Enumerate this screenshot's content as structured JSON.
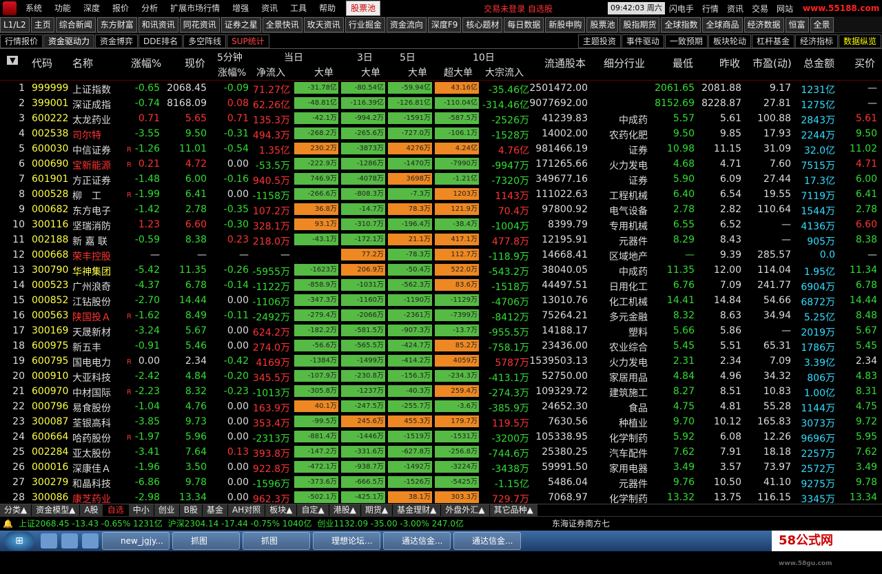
{
  "menubar": {
    "items": [
      "系统",
      "功能",
      "深度",
      "报价",
      "分析",
      "扩展市场行情",
      "增强",
      "资讯",
      "工具",
      "帮助"
    ],
    "pool_tab": "股票池",
    "notice": "交易未登录  自选股",
    "time": "09:42:03",
    "weekday": "周六",
    "right_items": [
      "闪电手",
      "行情",
      "资讯",
      "交易",
      "网站"
    ],
    "watermark": "www.55188.com"
  },
  "toolbar": {
    "buttons": [
      "L1/L2",
      "主页",
      "综合新闻",
      "东方财富",
      "和讯资讯",
      "同花资讯",
      "证券之星",
      "全景快讯",
      "玫天资讯",
      "行业掘金",
      "资金流向",
      "深度F9",
      "核心题材",
      "每日数据",
      "新股申购",
      "股票池",
      "股指期货",
      "全球指数",
      "全球商品",
      "经济数据",
      "恒富",
      "全景"
    ]
  },
  "tabs": {
    "left": [
      "行情报价",
      "资金驱动力",
      "资金博弈",
      "DDE排名",
      "多空阵线",
      "SUP统计"
    ],
    "right": [
      "主题投资",
      "事件驱动",
      "一致预期",
      "板块轮动",
      "杠杆基金",
      "经济指标",
      "数据纵览"
    ]
  },
  "columns": {
    "sort": "▼",
    "code": "代码",
    "name": "名称",
    "change": "涨幅%",
    "price": "现价",
    "m5_top": "5分钟",
    "m5": "涨幅%",
    "today": "当日",
    "net": "净流入",
    "big": "大单",
    "d3": "3日",
    "d3big": "大单",
    "d5": "5日",
    "d5big": "大单",
    "d10": "10日",
    "super": "超大单",
    "block": "大宗流入",
    "float": "流通股本",
    "industry": "细分行业",
    "low": "最低",
    "prev": "昨收",
    "pe": "市盈(动)",
    "amount": "总金额",
    "bid": "买价"
  },
  "rows": [
    {
      "n": 1,
      "code": "999999",
      "name": "上证指数",
      "f": "",
      "chg": "-0.65",
      "price": "2068.45",
      "m5": "-0.09",
      "net": "71.27亿",
      "b1": "-31.78亿",
      "b1v": -31.78,
      "b3": "-80.54亿",
      "b3v": -80.54,
      "b5": "-59.94亿",
      "b5v": -59.94,
      "sb": "43.16亿",
      "sbv": 43.16,
      "blk": "-35.46亿",
      "flt": "2501472.00",
      "ind": "",
      "low": "2061.65",
      "prev": "2081.88",
      "pe": "9.17",
      "amt": "1231亿",
      "bid": "—",
      "nc": "w",
      "pc": "w"
    },
    {
      "n": 2,
      "code": "399001",
      "name": "深证成指",
      "f": "",
      "chg": "-0.74",
      "price": "8168.09",
      "m5": "0.08",
      "net": "62.26亿",
      "b1": "-48.81亿",
      "b1v": -48.81,
      "b3": "-116.39亿",
      "b3v": -116.39,
      "b5": "-126.81亿",
      "b5v": -126.81,
      "sb": "-110.04亿",
      "sbv": -110.04,
      "blk": "-314.46亿",
      "flt": "9077692.00",
      "ind": "",
      "low": "8152.69",
      "prev": "8228.87",
      "pe": "27.81",
      "amt": "1275亿",
      "bid": "—",
      "nc": "w",
      "pc": "w"
    },
    {
      "n": 3,
      "code": "600222",
      "name": "太龙药业",
      "f": "",
      "chg": "0.71",
      "price": "5.65",
      "m5": "0.71",
      "net": "135.3万",
      "b1": "-42.1万",
      "b1v": -42.1,
      "b3": "-994.2万",
      "b3v": -994.2,
      "b5": "-1591万",
      "b5v": -1591,
      "sb": "-587.5万",
      "sbv": -587.5,
      "blk": "-2526万",
      "flt": "41239.83",
      "ind": "中成药",
      "low": "5.57",
      "prev": "5.61",
      "pe": "100.88",
      "amt": "2843万",
      "bid": "5.61",
      "nc": "w",
      "pc": "r"
    },
    {
      "n": 4,
      "code": "002538",
      "name": "司尔特",
      "f": "",
      "chg": "-3.55",
      "price": "9.50",
      "m5": "-0.31",
      "net": "494.3万",
      "b1": "-268.2万",
      "b1v": -268.2,
      "b3": "-265.6万",
      "b3v": -265.6,
      "b5": "-727.0万",
      "b5v": -727,
      "sb": "-106.1万",
      "sbv": -106.1,
      "blk": "-1528万",
      "flt": "14002.00",
      "ind": "农药化肥",
      "low": "9.50",
      "prev": "9.85",
      "pe": "17.93",
      "amt": "2244万",
      "bid": "9.50",
      "nc": "r",
      "pc": "g"
    },
    {
      "n": 5,
      "code": "600030",
      "name": "中信证券",
      "f": "R",
      "chg": "-1.26",
      "price": "11.01",
      "m5": "-0.54",
      "net": "1.35亿",
      "b1": "230.2万",
      "b1v": 230.2,
      "b3": "-3873万",
      "b3v": -3873,
      "b5": "4276万",
      "b5v": 4276,
      "sb": "4.24亿",
      "sbv": 4.24,
      "blk": "4.76亿",
      "flt": "981466.19",
      "ind": "证券",
      "low": "10.98",
      "prev": "11.15",
      "pe": "31.09",
      "amt": "32.0亿",
      "bid": "11.02",
      "nc": "w",
      "pc": "g"
    },
    {
      "n": 6,
      "code": "000690",
      "name": "宝新能源",
      "f": "R",
      "chg": "0.21",
      "price": "4.72",
      "m5": "0.00",
      "net": "-53.5万",
      "b1": "-222.9万",
      "b1v": -222.9,
      "b3": "-1286万",
      "b3v": -1286,
      "b5": "-1470万",
      "b5v": -1470,
      "sb": "-7990万",
      "sbv": -7990,
      "blk": "-9947万",
      "flt": "171265.66",
      "ind": "火力发电",
      "low": "4.68",
      "prev": "4.71",
      "pe": "7.60",
      "amt": "7515万",
      "bid": "4.71",
      "nc": "r",
      "pc": "r"
    },
    {
      "n": 7,
      "code": "601901",
      "name": "方正证券",
      "f": "",
      "chg": "-1.48",
      "price": "6.00",
      "m5": "-0.16",
      "net": "940.5万",
      "b1": "746.9万",
      "b1v": -746.9,
      "b3": "-4078万",
      "b3v": -4078,
      "b5": "3698万",
      "b5v": 3698,
      "sb": "-1.21亿",
      "sbv": -1.21,
      "blk": "-7320万",
      "flt": "349677.16",
      "ind": "证券",
      "low": "5.90",
      "prev": "6.09",
      "pe": "27.44",
      "amt": "17.3亿",
      "bid": "6.00",
      "nc": "w",
      "pc": "g"
    },
    {
      "n": 8,
      "code": "000528",
      "name": "柳　工",
      "f": "R",
      "chg": "-1.99",
      "price": "6.41",
      "m5": "0.00",
      "net": "-1158万",
      "b1": "-266.6万",
      "b1v": -266.6,
      "b3": "-808.3万",
      "b3v": -808.3,
      "b5": "-7.3万",
      "b5v": -7.3,
      "sb": "1203万",
      "sbv": 1203,
      "blk": "1143万",
      "flt": "111022.63",
      "ind": "工程机械",
      "low": "6.40",
      "prev": "6.54",
      "pe": "19.55",
      "amt": "7119万",
      "bid": "6.41",
      "nc": "w",
      "pc": "g"
    },
    {
      "n": 9,
      "code": "000682",
      "name": "东方电子",
      "f": "",
      "chg": "-1.42",
      "price": "2.78",
      "m5": "-0.35",
      "net": "107.2万",
      "b1": "36.8万",
      "b1v": 36.8,
      "b3": "-14.7万",
      "b3v": -14.7,
      "b5": "78.3万",
      "b5v": 78.3,
      "sb": "121.9万",
      "sbv": 121.9,
      "blk": "70.4万",
      "flt": "97800.92",
      "ind": "电气设备",
      "low": "2.78",
      "prev": "2.82",
      "pe": "110.64",
      "amt": "1544万",
      "bid": "2.78",
      "nc": "w",
      "pc": "g"
    },
    {
      "n": 10,
      "code": "300116",
      "name": "坚瑞消防",
      "f": "",
      "chg": "1.23",
      "price": "6.60",
      "m5": "-0.30",
      "net": "328.1万",
      "b1": "93.1万",
      "b1v": 93.1,
      "b3": "-310.7万",
      "b3v": -310.7,
      "b5": "-196.4万",
      "b5v": -196.4,
      "sb": "-38.4万",
      "sbv": -38.4,
      "blk": "-1004万",
      "flt": "8399.79",
      "ind": "专用机械",
      "low": "6.55",
      "prev": "6.52",
      "pe": "—",
      "amt": "4136万",
      "bid": "6.60",
      "nc": "w",
      "pc": "r"
    },
    {
      "n": 11,
      "code": "002188",
      "name": "新 嘉 联",
      "f": "",
      "chg": "-0.59",
      "price": "8.38",
      "m5": "0.23",
      "net": "218.0万",
      "b1": "-43.1万",
      "b1v": -43.1,
      "b3": "-172.1万",
      "b3v": -172.1,
      "b5": "21.1万",
      "b5v": 21.1,
      "sb": "417.1万",
      "sbv": 417.1,
      "blk": "477.8万",
      "flt": "12195.91",
      "ind": "元器件",
      "low": "8.29",
      "prev": "8.43",
      "pe": "—",
      "amt": "905万",
      "bid": "8.38",
      "nc": "w",
      "pc": "g"
    },
    {
      "n": 12,
      "code": "000668",
      "name": "荣丰控股",
      "f": "",
      "chg": "—",
      "price": "—",
      "m5": "—",
      "net": "—",
      "b1": "",
      "b1v": 0,
      "b3": "77.2万",
      "b3v": 77.2,
      "b5": "-78.3万",
      "b5v": -78.3,
      "sb": "112.7万",
      "sbv": 112.7,
      "blk": "-118.9万",
      "flt": "14668.41",
      "ind": "区域地产",
      "low": "—",
      "prev": "9.39",
      "pe": "285.57",
      "amt": "0.0",
      "bid": "—",
      "nc": "r",
      "pc": "w"
    },
    {
      "n": 13,
      "code": "300790",
      "name": "华神集团",
      "f": "",
      "chg": "-5.42",
      "price": "11.35",
      "m5": "-0.26",
      "net": "-5955万",
      "b1": "-1623万",
      "b1v": -1623,
      "b3": "206.9万",
      "b3v": 206.9,
      "b5": "-50.4万",
      "b5v": -50.4,
      "sb": "522.0万",
      "sbv": 522,
      "blk": "-543.2万",
      "flt": "38040.05",
      "ind": "中成药",
      "low": "11.35",
      "prev": "12.00",
      "pe": "114.04",
      "amt": "1.95亿",
      "bid": "11.34",
      "nc": "y",
      "pc": "g"
    },
    {
      "n": 14,
      "code": "000523",
      "name": "广州浪奇",
      "f": "",
      "chg": "-4.37",
      "price": "6.78",
      "m5": "-0.14",
      "net": "-1122万",
      "b1": "-858.9万",
      "b1v": -858.9,
      "b3": "-1031万",
      "b3v": -1031,
      "b5": "-562.3万",
      "b5v": -562.3,
      "sb": "83.6万",
      "sbv": 83.6,
      "blk": "-1518万",
      "flt": "44497.51",
      "ind": "日用化工",
      "low": "6.76",
      "prev": "7.09",
      "pe": "241.77",
      "amt": "6904万",
      "bid": "6.78",
      "nc": "w",
      "pc": "g"
    },
    {
      "n": 15,
      "code": "000852",
      "name": "江钻股份",
      "f": "",
      "chg": "-2.70",
      "price": "14.44",
      "m5": "0.00",
      "net": "-1106万",
      "b1": "-347.3万",
      "b1v": -347.3,
      "b3": "-1160万",
      "b3v": -1160,
      "b5": "-1190万",
      "b5v": -1190,
      "sb": "-1129万",
      "sbv": -1129,
      "blk": "-4706万",
      "flt": "13010.76",
      "ind": "化工机械",
      "low": "14.41",
      "prev": "14.84",
      "pe": "54.66",
      "amt": "6872万",
      "bid": "14.44",
      "nc": "w",
      "pc": "g"
    },
    {
      "n": 16,
      "code": "000563",
      "name": "陕国投Ａ",
      "f": "R",
      "chg": "-1.62",
      "price": "8.49",
      "m5": "-0.11",
      "net": "-2492万",
      "b1": "-279.4万",
      "b1v": -279.4,
      "b3": "-2066万",
      "b3v": -2066,
      "b5": "-2361万",
      "b5v": -2361,
      "sb": "-7399万",
      "sbv": -7399,
      "blk": "-8412万",
      "flt": "75264.21",
      "ind": "多元金融",
      "low": "8.32",
      "prev": "8.63",
      "pe": "34.94",
      "amt": "5.25亿",
      "bid": "8.48",
      "nc": "r",
      "pc": "g"
    },
    {
      "n": 17,
      "code": "300169",
      "name": "天晟新材",
      "f": "",
      "chg": "-3.24",
      "price": "5.67",
      "m5": "0.00",
      "net": "624.2万",
      "b1": "-182.2万",
      "b1v": -182.2,
      "b3": "-581.5万",
      "b3v": -581.5,
      "b5": "-907.3万",
      "b5v": -907.3,
      "sb": "-13.7万",
      "sbv": -13.7,
      "blk": "-955.5万",
      "flt": "14188.17",
      "ind": "塑料",
      "low": "5.66",
      "prev": "5.86",
      "pe": "—",
      "amt": "2019万",
      "bid": "5.67",
      "nc": "w",
      "pc": "g"
    },
    {
      "n": 18,
      "code": "600975",
      "name": "新五丰",
      "f": "",
      "chg": "-0.91",
      "price": "5.46",
      "m5": "0.00",
      "net": "274.0万",
      "b1": "-56.6万",
      "b1v": -56.6,
      "b3": "-565.5万",
      "b3v": -565.5,
      "b5": "-424.7万",
      "b5v": -424.7,
      "sb": "85.2万",
      "sbv": 85.2,
      "blk": "-758.1万",
      "flt": "23436.00",
      "ind": "农业综合",
      "low": "5.45",
      "prev": "5.51",
      "pe": "65.31",
      "amt": "1786万",
      "bid": "5.45",
      "nc": "w",
      "pc": "g"
    },
    {
      "n": 19,
      "code": "600795",
      "name": "国电电力",
      "f": "R",
      "chg": "0.00",
      "price": "2.34",
      "m5": "-0.42",
      "net": "4169万",
      "b1": "-1384万",
      "b1v": -1384,
      "b3": "-1499万",
      "b3v": -1499,
      "b5": "-414.2万",
      "b5v": -414.2,
      "sb": "4059万",
      "sbv": 4059,
      "blk": "5787万",
      "flt": "1539503.13",
      "ind": "火力发电",
      "low": "2.31",
      "prev": "2.34",
      "pe": "7.09",
      "amt": "3.39亿",
      "bid": "2.34",
      "nc": "w",
      "pc": "w"
    },
    {
      "n": 20,
      "code": "000910",
      "name": "大亚科技",
      "f": "",
      "chg": "-2.42",
      "price": "4.84",
      "m5": "-0.20",
      "net": "345.5万",
      "b1": "-107.9万",
      "b1v": -107.9,
      "b3": "-230.8万",
      "b3v": -230.8,
      "b5": "-156.3万",
      "b5v": -156.3,
      "sb": "-234.3万",
      "sbv": -234.3,
      "blk": "-413.1万",
      "flt": "52750.00",
      "ind": "家居用品",
      "low": "4.84",
      "prev": "4.96",
      "pe": "34.32",
      "amt": "806万",
      "bid": "4.83",
      "nc": "w",
      "pc": "g"
    },
    {
      "n": 21,
      "code": "600970",
      "name": "中材国际",
      "f": "R",
      "chg": "-2.23",
      "price": "8.32",
      "m5": "-0.23",
      "net": "-1013万",
      "b1": "-305.8万",
      "b1v": -305.8,
      "b3": "-1237万",
      "b3v": -1237,
      "b5": "-40.3万",
      "b5v": -40.3,
      "sb": "259.4万",
      "sbv": 259.4,
      "blk": "-274.3万",
      "flt": "109329.72",
      "ind": "建筑施工",
      "low": "8.27",
      "prev": "8.51",
      "pe": "10.83",
      "amt": "1.00亿",
      "bid": "8.31",
      "nc": "w",
      "pc": "g"
    },
    {
      "n": 22,
      "code": "000796",
      "name": "易食股份",
      "f": "",
      "chg": "-1.04",
      "price": "4.76",
      "m5": "0.00",
      "net": "163.9万",
      "b1": "40.1万",
      "b1v": 40.1,
      "b3": "-247.5万",
      "b3v": -247.5,
      "b5": "-255.7万",
      "b5v": -255.7,
      "sb": "-3.6万",
      "sbv": -3.6,
      "blk": "-385.9万",
      "flt": "24652.30",
      "ind": "食品",
      "low": "4.75",
      "prev": "4.81",
      "pe": "55.28",
      "amt": "1144万",
      "bid": "4.75",
      "nc": "w",
      "pc": "g"
    },
    {
      "n": 23,
      "code": "300087",
      "name": "荃银高科",
      "f": "",
      "chg": "-3.85",
      "price": "9.73",
      "m5": "0.00",
      "net": "353.4万",
      "b1": "-99.5万",
      "b1v": -99.5,
      "b3": "245.6万",
      "b3v": 245.6,
      "b5": "455.3万",
      "b5v": 455.3,
      "sb": "179.7万",
      "sbv": 179.7,
      "blk": "119.5万",
      "flt": "7630.56",
      "ind": "种植业",
      "low": "9.70",
      "prev": "10.12",
      "pe": "165.83",
      "amt": "3073万",
      "bid": "9.72",
      "nc": "w",
      "pc": "g"
    },
    {
      "n": 24,
      "code": "600664",
      "name": "哈药股份",
      "f": "R",
      "chg": "-1.97",
      "price": "5.96",
      "m5": "0.00",
      "net": "-2313万",
      "b1": "-881.4万",
      "b1v": -881.4,
      "b3": "-1446万",
      "b3v": -1446,
      "b5": "-1519万",
      "b5v": -1519,
      "sb": "-1531万",
      "sbv": -1531,
      "blk": "-3200万",
      "flt": "105338.95",
      "ind": "化学制药",
      "low": "5.92",
      "prev": "6.08",
      "pe": "12.26",
      "amt": "9696万",
      "bid": "5.95",
      "nc": "w",
      "pc": "g"
    },
    {
      "n": 25,
      "code": "002284",
      "name": "亚太股份",
      "f": "",
      "chg": "-3.41",
      "price": "7.64",
      "m5": "0.13",
      "net": "393.8万",
      "b1": "-147.2万",
      "b1v": -147.2,
      "b3": "-331.6万",
      "b3v": -331.6,
      "b5": "-627.8万",
      "b5v": -627.8,
      "sb": "-256.8万",
      "sbv": -256.8,
      "blk": "-744.6万",
      "flt": "25380.25",
      "ind": "汽车配件",
      "low": "7.62",
      "prev": "7.91",
      "pe": "18.18",
      "amt": "2257万",
      "bid": "7.62",
      "nc": "w",
      "pc": "g"
    },
    {
      "n": 26,
      "code": "000016",
      "name": "深康佳Ａ",
      "f": "",
      "chg": "-1.96",
      "price": "3.50",
      "m5": "0.00",
      "net": "922.8万",
      "b1": "-472.1万",
      "b1v": -472.1,
      "b3": "-938.7万",
      "b3v": -938.7,
      "b5": "-1492万",
      "b5v": -1492,
      "sb": "-3224万",
      "sbv": -3224,
      "blk": "-3438万",
      "flt": "59991.50",
      "ind": "家用电器",
      "low": "3.49",
      "prev": "3.57",
      "pe": "73.97",
      "amt": "2572万",
      "bid": "3.49",
      "nc": "w",
      "pc": "g"
    },
    {
      "n": 27,
      "code": "300279",
      "name": "和晶科技",
      "f": "",
      "chg": "-6.86",
      "price": "9.78",
      "m5": "0.00",
      "net": "-1596万",
      "b1": "-373.6万",
      "b1v": -373.6,
      "b3": "-666.5万",
      "b3v": -666.5,
      "b5": "-1526万",
      "b5v": -1526,
      "sb": "-5425万",
      "sbv": -5425,
      "blk": "-1.15亿",
      "flt": "5486.04",
      "ind": "元器件",
      "low": "9.76",
      "prev": "10.50",
      "pe": "41.10",
      "amt": "9275万",
      "bid": "9.78",
      "nc": "w",
      "pc": "g"
    },
    {
      "n": 28,
      "code": "300086",
      "name": "康芝药业",
      "f": "",
      "chg": "-2.98",
      "price": "13.34",
      "m5": "0.00",
      "net": "962.3万",
      "b1": "-502.1万",
      "b1v": -502.1,
      "b3": "-425.1万",
      "b3v": -425.1,
      "b5": "38.1万",
      "b5v": 38.1,
      "sb": "303.3万",
      "sbv": 303.3,
      "blk": "729.7万",
      "flt": "7068.97",
      "ind": "化学制药",
      "low": "13.32",
      "prev": "13.75",
      "pe": "116.15",
      "amt": "3345万",
      "bid": "13.34",
      "nc": "r",
      "pc": "g"
    }
  ],
  "bottom_tabs": [
    "分类▲",
    "资金模型▲",
    "A股",
    "自选",
    "中小",
    "创业",
    "B股",
    "基金",
    "AH对照",
    "板块▲",
    "自定▲",
    "港股▲",
    "期货▲",
    "基金理财▲",
    "外盘外汇▲",
    "其它品种▲"
  ],
  "bottom_active": "自选",
  "status": {
    "sh": "上证2068.45 -13.43 -0.65% 1231亿",
    "hs": "沪深2304.14 -17.44 -0.75% 1040亿",
    "cy": "创业1132.09 -35.00 -3.00% 247.0亿",
    "broker": "东海证券南方七"
  },
  "taskbar": {
    "tasks": [
      "new_jgjy...",
      "抓图",
      "抓图",
      "理想论坛...",
      "通达信金...",
      "通达信金..."
    ],
    "brand": "58公式网",
    "brand_url": "www.58gu.com"
  },
  "colors": {
    "up": "#ff3333",
    "down": "#33dd33",
    "text": "#dddddd",
    "yellow": "#ffff44",
    "cyan": "#33ddff",
    "bar_green": "#55bb44",
    "bar_orange": "#ee8822"
  }
}
